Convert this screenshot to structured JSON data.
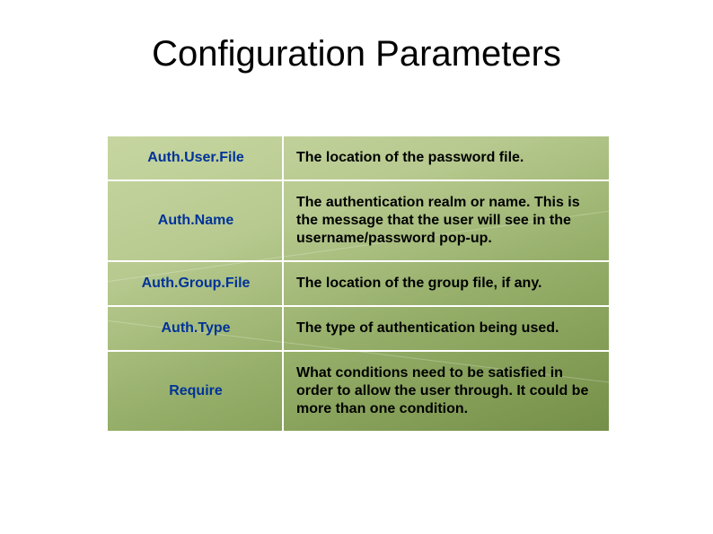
{
  "title": "Configuration Parameters",
  "rows": [
    {
      "key": "Auth.User.File",
      "desc": "The location of the password file."
    },
    {
      "key": "Auth.Name",
      "desc": "The authentication realm or name. This is the message that the user will see in the username/password pop-up."
    },
    {
      "key": "Auth.Group.File",
      "desc": "The location of the group file, if any."
    },
    {
      "key": "Auth.Type",
      "desc": "The type of authentication being used."
    },
    {
      "key": "Require",
      "desc": "What conditions need to be satisfied in order to allow the user through. It could be more than one condition."
    }
  ]
}
